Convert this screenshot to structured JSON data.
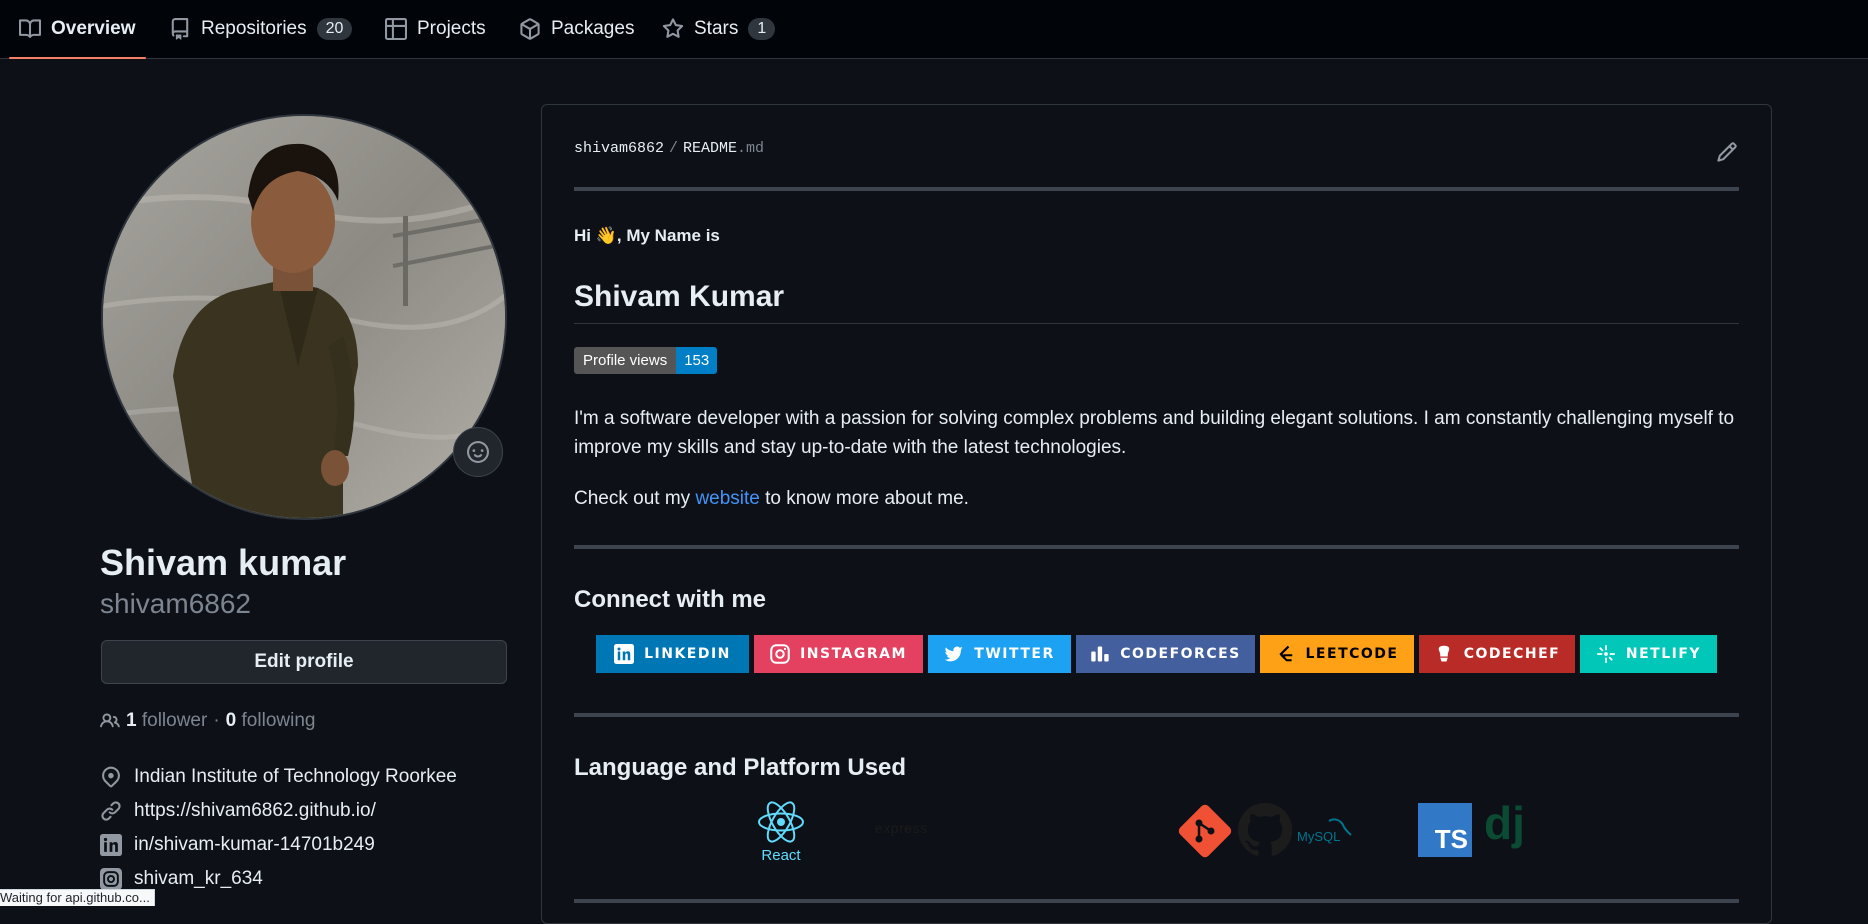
{
  "nav": {
    "tabs": [
      {
        "label": "Overview",
        "icon": "book-icon",
        "active": true
      },
      {
        "label": "Repositories",
        "icon": "repo-icon",
        "count": "20"
      },
      {
        "label": "Projects",
        "icon": "table-icon"
      },
      {
        "label": "Packages",
        "icon": "package-icon"
      },
      {
        "label": "Stars",
        "icon": "star-icon",
        "count": "1"
      }
    ]
  },
  "profile": {
    "name": "Shivam kumar",
    "login": "shivam6862",
    "edit_label": "Edit profile",
    "followers_count": "1",
    "followers_label": "follower",
    "separator": "·",
    "following_count": "0",
    "following_label": "following",
    "details": [
      {
        "icon": "location-icon",
        "text": "Indian Institute of Technology Roorkee"
      },
      {
        "icon": "link-icon",
        "text": "https://shivam6862.github.io/"
      },
      {
        "icon": "linkedin-icon",
        "text": "in/shivam-kumar-14701b249"
      },
      {
        "icon": "instagram-icon",
        "text": "shivam_kr_634"
      }
    ]
  },
  "readme": {
    "owner": "shivam6862",
    "separator": "/",
    "file": "README",
    "ext": ".md",
    "greeting": "Hi 👋, My Name is",
    "heading": "Shivam Kumar",
    "views_label": "Profile views",
    "views_count": "153",
    "intro": "I'm a software developer with a passion for solving complex problems and building elegant solutions. I am constantly challenging myself to improve my skills and stay up-to-date with the latest technologies.",
    "check_pre": "Check out my ",
    "check_link": "website",
    "check_post": " to know more about me.",
    "connect_title": "Connect with me",
    "badges": [
      {
        "label": "LINKEDIN",
        "color": "#0077b5"
      },
      {
        "label": "INSTAGRAM",
        "color": "#e4405f"
      },
      {
        "label": "TWITTER",
        "color": "#1da1f2"
      },
      {
        "label": "CODEFORCES",
        "color": "#445f9d"
      },
      {
        "label": "LEETCODE",
        "color": "#ffa116"
      },
      {
        "label": "CODECHEF",
        "color": "#b92b27"
      },
      {
        "label": "NETLIFY",
        "color": "#00c7b7"
      }
    ],
    "lang_title": "Language and Platform Used",
    "logos": {
      "react": "React",
      "express": "express",
      "mysql": "MySQL",
      "ts": "TS",
      "django": "dj"
    }
  },
  "status_bar": "Waiting for api.github.co..."
}
